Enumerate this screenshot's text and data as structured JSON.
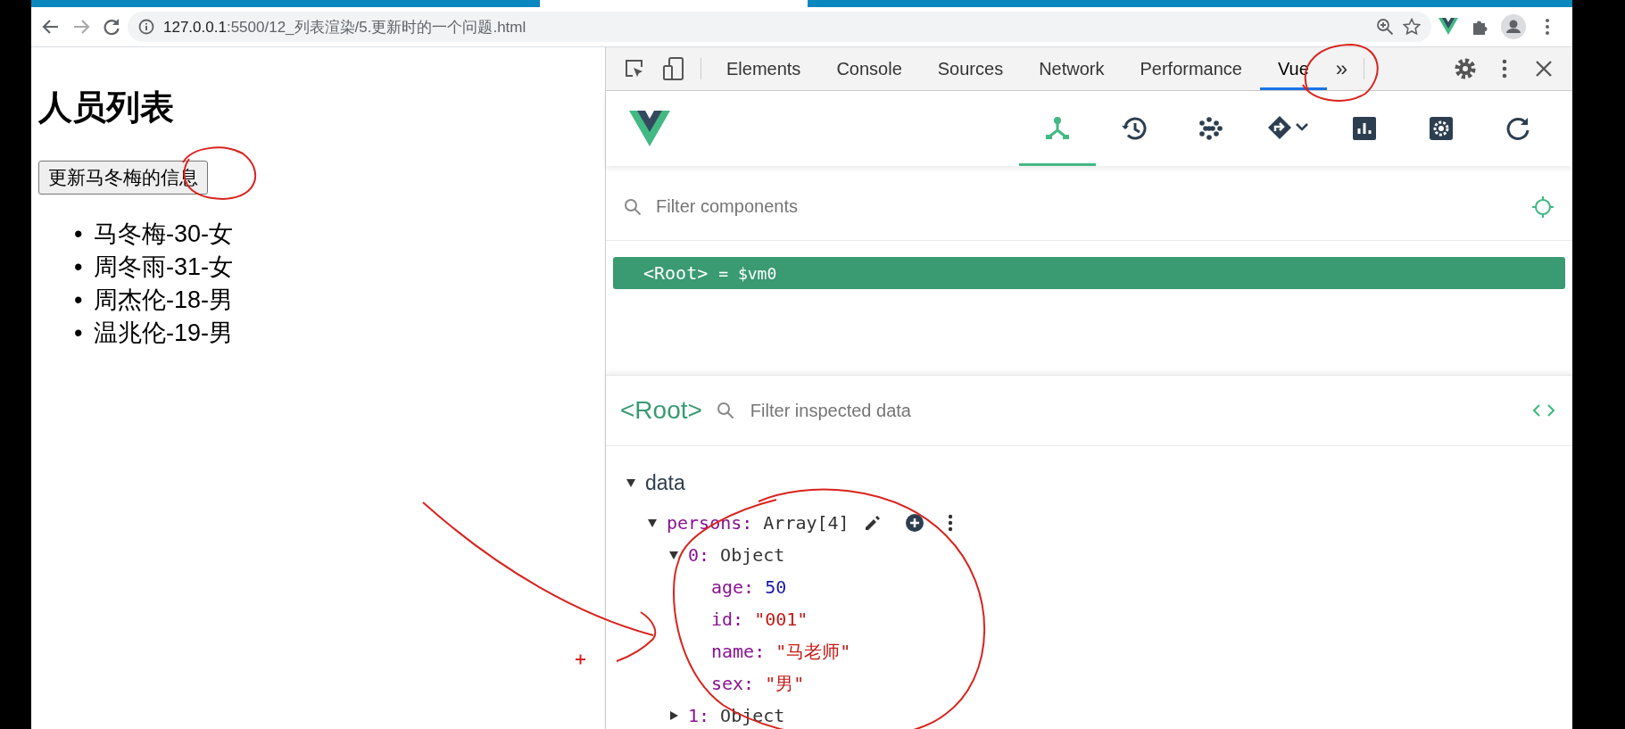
{
  "address_bar": {
    "host": "127.0.0.1",
    "path": ":5500/12_列表渲染/5.更新时的一个问题.html"
  },
  "page": {
    "heading": "人员列表",
    "button": "更新马冬梅的信息",
    "persons": [
      {
        "marker": "•",
        "text": "马冬梅-30-女"
      },
      {
        "marker": "•",
        "text": "周冬雨-31-女"
      },
      {
        "marker": "•",
        "text": "周杰伦-18-男"
      },
      {
        "marker": "•",
        "text": "温兆伦-19-男"
      }
    ]
  },
  "devtools": {
    "tabs": [
      {
        "label": "Elements",
        "selected": false
      },
      {
        "label": "Console",
        "selected": false
      },
      {
        "label": "Sources",
        "selected": false
      },
      {
        "label": "Network",
        "selected": false
      },
      {
        "label": "Performance",
        "selected": false
      },
      {
        "label": "Vue",
        "selected": true
      }
    ],
    "overflow": "»",
    "vue_toolbar": [
      {
        "kind": "components",
        "selected": true
      },
      {
        "kind": "timeline",
        "selected": false
      },
      {
        "kind": "vuex",
        "selected": false
      },
      {
        "kind": "routing",
        "selected": false
      },
      {
        "kind": "performance",
        "selected": false
      },
      {
        "kind": "settings",
        "selected": false
      },
      {
        "kind": "refresh",
        "selected": false
      }
    ],
    "component_filter": {
      "placeholder": "Filter components"
    },
    "component_tree": [
      {
        "label": "<Root>",
        "ref": "= $vm0",
        "selected": true
      }
    ],
    "inspector": {
      "title": "<Root>",
      "filter_placeholder": "Filter inspected data",
      "sections": [
        {
          "name": "data",
          "expanded": true,
          "fields": [
            {
              "key": "persons:",
              "value": "Array[4]",
              "kind": "object",
              "expanded": true,
              "hovered": true,
              "children": [
                {
                  "key": "0:",
                  "value": "Object",
                  "kind": "object",
                  "expanded": true,
                  "children": [
                    {
                      "key": "age:",
                      "value": "50",
                      "kind": "number"
                    },
                    {
                      "key": "id:",
                      "value": "\"001\"",
                      "kind": "string"
                    },
                    {
                      "key": "name:",
                      "value": "\"马老师\"",
                      "kind": "string"
                    },
                    {
                      "key": "sex:",
                      "value": "\"男\"",
                      "kind": "string"
                    }
                  ]
                },
                {
                  "key": "1:",
                  "value": "Object",
                  "kind": "object",
                  "expanded": false
                }
              ]
            }
          ]
        }
      ]
    }
  }
}
